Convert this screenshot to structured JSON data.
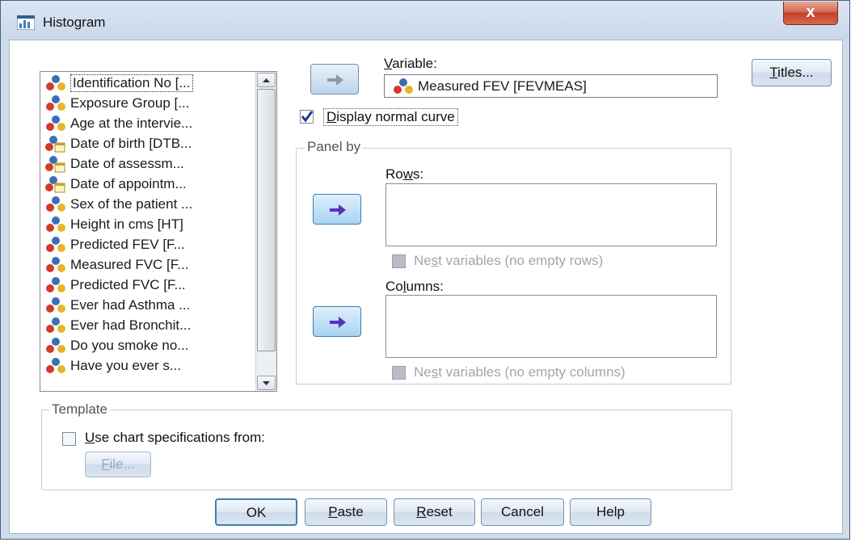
{
  "window": {
    "title": "Histogram",
    "close_label": "x"
  },
  "variables": {
    "items": [
      {
        "label": "Identification No [...",
        "icon": "nominal-variable-icon"
      },
      {
        "label": "Exposure Group [...",
        "icon": "nominal-variable-icon"
      },
      {
        "label": "Age at the intervie...",
        "icon": "nominal-variable-icon"
      },
      {
        "label": "Date of birth [DTB...",
        "icon": "date-variable-icon"
      },
      {
        "label": "Date of assessm...",
        "icon": "date-variable-icon"
      },
      {
        "label": "Date of appointm...",
        "icon": "date-variable-icon"
      },
      {
        "label": "Sex of the patient ...",
        "icon": "nominal-variable-icon"
      },
      {
        "label": "Height in cms [HT]",
        "icon": "nominal-variable-icon"
      },
      {
        "label": "Predicted FEV [F...",
        "icon": "nominal-variable-icon"
      },
      {
        "label": "Measured FVC [F...",
        "icon": "nominal-variable-icon"
      },
      {
        "label": "Predicted FVC [F...",
        "icon": "nominal-variable-icon"
      },
      {
        "label": "Ever had Asthma ...",
        "icon": "nominal-variable-icon"
      },
      {
        "label": "Ever had Bronchit...",
        "icon": "nominal-variable-icon"
      },
      {
        "label": "Do you smoke no...",
        "icon": "nominal-variable-icon"
      },
      {
        "label": "Have you ever s...",
        "icon": "nominal-variable-icon"
      }
    ]
  },
  "variable_field": {
    "label_key": "V",
    "label_rest": "ariable:",
    "value": "Measured FEV [FEVMEAS]"
  },
  "normal_curve": {
    "key": "D",
    "rest": "isplay normal curve",
    "checked": true
  },
  "panel": {
    "title": "Panel by",
    "rows_pre": "Ro",
    "rows_key": "w",
    "rows_post": "s:",
    "nest_rows_pre": "Ne",
    "nest_rows_key": "s",
    "nest_rows_post": "t variables (no empty rows)",
    "columns_pre": "Co",
    "columns_key": "l",
    "columns_post": "umns:",
    "nest_cols_pre": "Ne",
    "nest_cols_key": "s",
    "nest_cols_post": "t variables (no empty columns)"
  },
  "template": {
    "title": "Template",
    "use_key": "U",
    "use_rest": "se chart specifications from:",
    "file_key": "F",
    "file_rest": "ile..."
  },
  "buttons": {
    "titles_key": "T",
    "titles_rest": "itles...",
    "ok": "OK",
    "paste_key": "P",
    "paste_rest": "aste",
    "reset_key": "R",
    "reset_rest": "eset",
    "cancel": "Cancel",
    "help": "Help"
  }
}
